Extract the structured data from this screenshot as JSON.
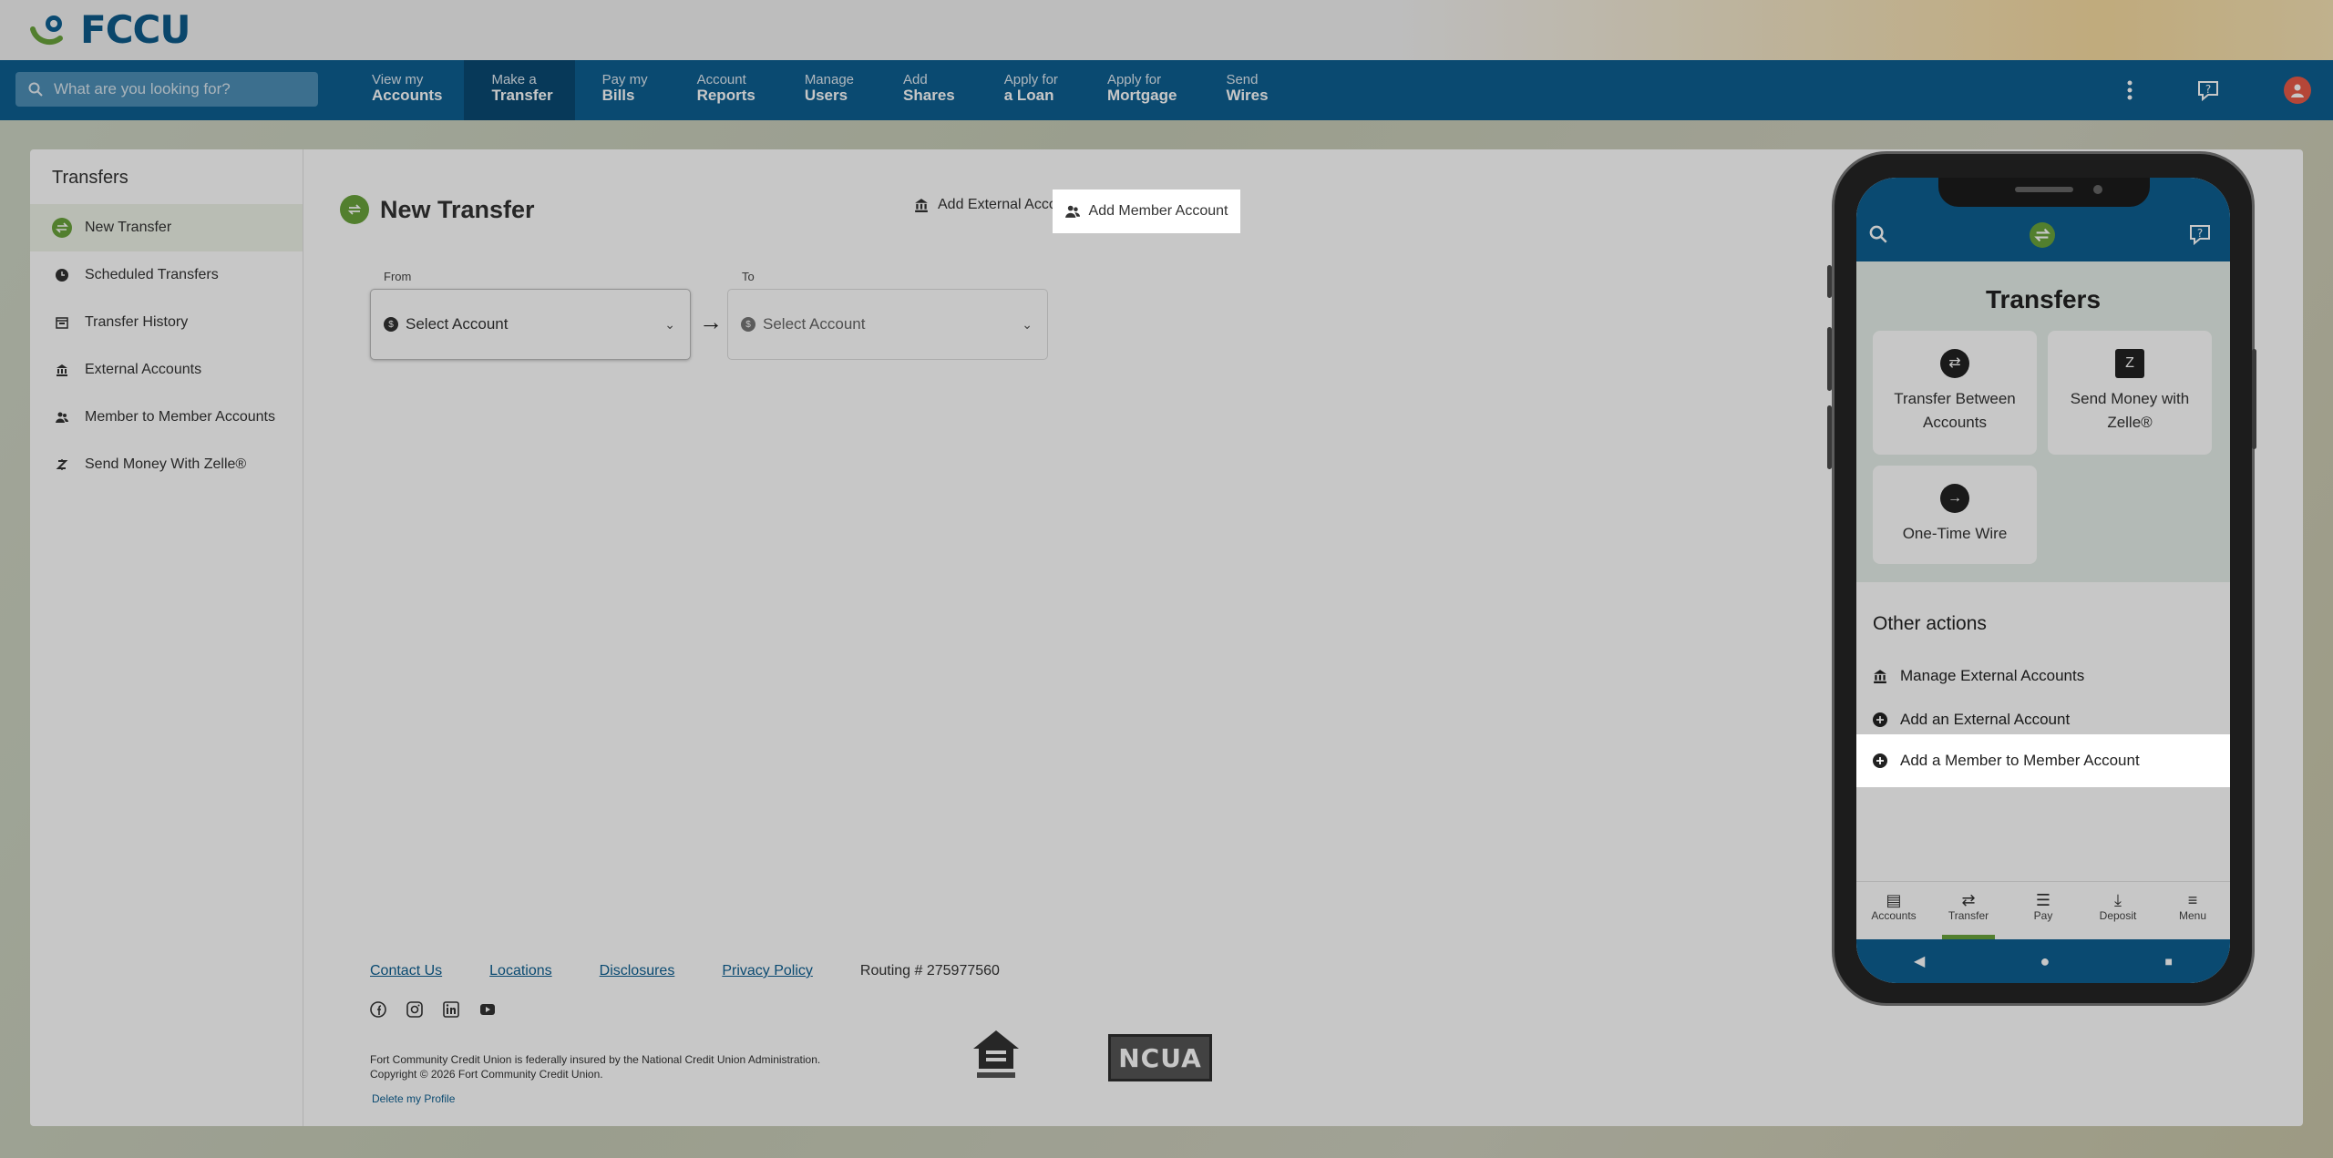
{
  "brand": {
    "name": "FCCU",
    "primary_color": "#0d5f91",
    "accent_color": "#6aa33b"
  },
  "search": {
    "placeholder": "What are you looking for?"
  },
  "nav": [
    {
      "line1": "View my",
      "line2": "Accounts"
    },
    {
      "line1": "Make a",
      "line2": "Transfer"
    },
    {
      "line1": "Pay my",
      "line2": "Bills"
    },
    {
      "line1": "Account",
      "line2": "Reports"
    },
    {
      "line1": "Manage",
      "line2": "Users"
    },
    {
      "line1": "Add",
      "line2": "Shares"
    },
    {
      "line1": "Apply for",
      "line2": "a Loan"
    },
    {
      "line1": "Apply for",
      "line2": "Mortgage"
    },
    {
      "line1": "Send",
      "line2": "Wires"
    }
  ],
  "sidebar": {
    "title": "Transfers",
    "items": [
      {
        "label": "New Transfer",
        "icon": "transfer-icon"
      },
      {
        "label": "Scheduled Transfers",
        "icon": "clock-icon"
      },
      {
        "label": "Transfer History",
        "icon": "calendar-icon"
      },
      {
        "label": "External Accounts",
        "icon": "bank-icon"
      },
      {
        "label": "Member to Member Accounts",
        "icon": "users-icon"
      },
      {
        "label": "Send Money With Zelle®",
        "icon": "zelle-icon"
      }
    ]
  },
  "main": {
    "title": "New Transfer",
    "add_external": "Add External Account",
    "add_member": "Add Member Account",
    "from_label": "From",
    "to_label": "To",
    "from_value": "Select Account",
    "to_value": "Select Account"
  },
  "footer": {
    "links": [
      "Contact Us",
      "Locations",
      "Disclosures",
      "Privacy Policy"
    ],
    "routing": "Routing # 275977560",
    "fine1": "Fort Community Credit Union is federally insured by the National Credit Union Administration.",
    "fine2": "Copyright © 2026 Fort Community Credit Union.",
    "delete": "Delete my Profile",
    "ncua": "NCUA"
  },
  "phone": {
    "title": "Transfers",
    "tiles": [
      "Transfer Between Accounts",
      "Send Money with Zelle®",
      "One-Time Wire"
    ],
    "other_title": "Other actions",
    "actions": [
      "Manage External Accounts",
      "Add an External Account",
      "Add a Member to Member Account"
    ],
    "tabs": [
      "Accounts",
      "Transfer",
      "Pay",
      "Deposit",
      "Menu"
    ]
  }
}
